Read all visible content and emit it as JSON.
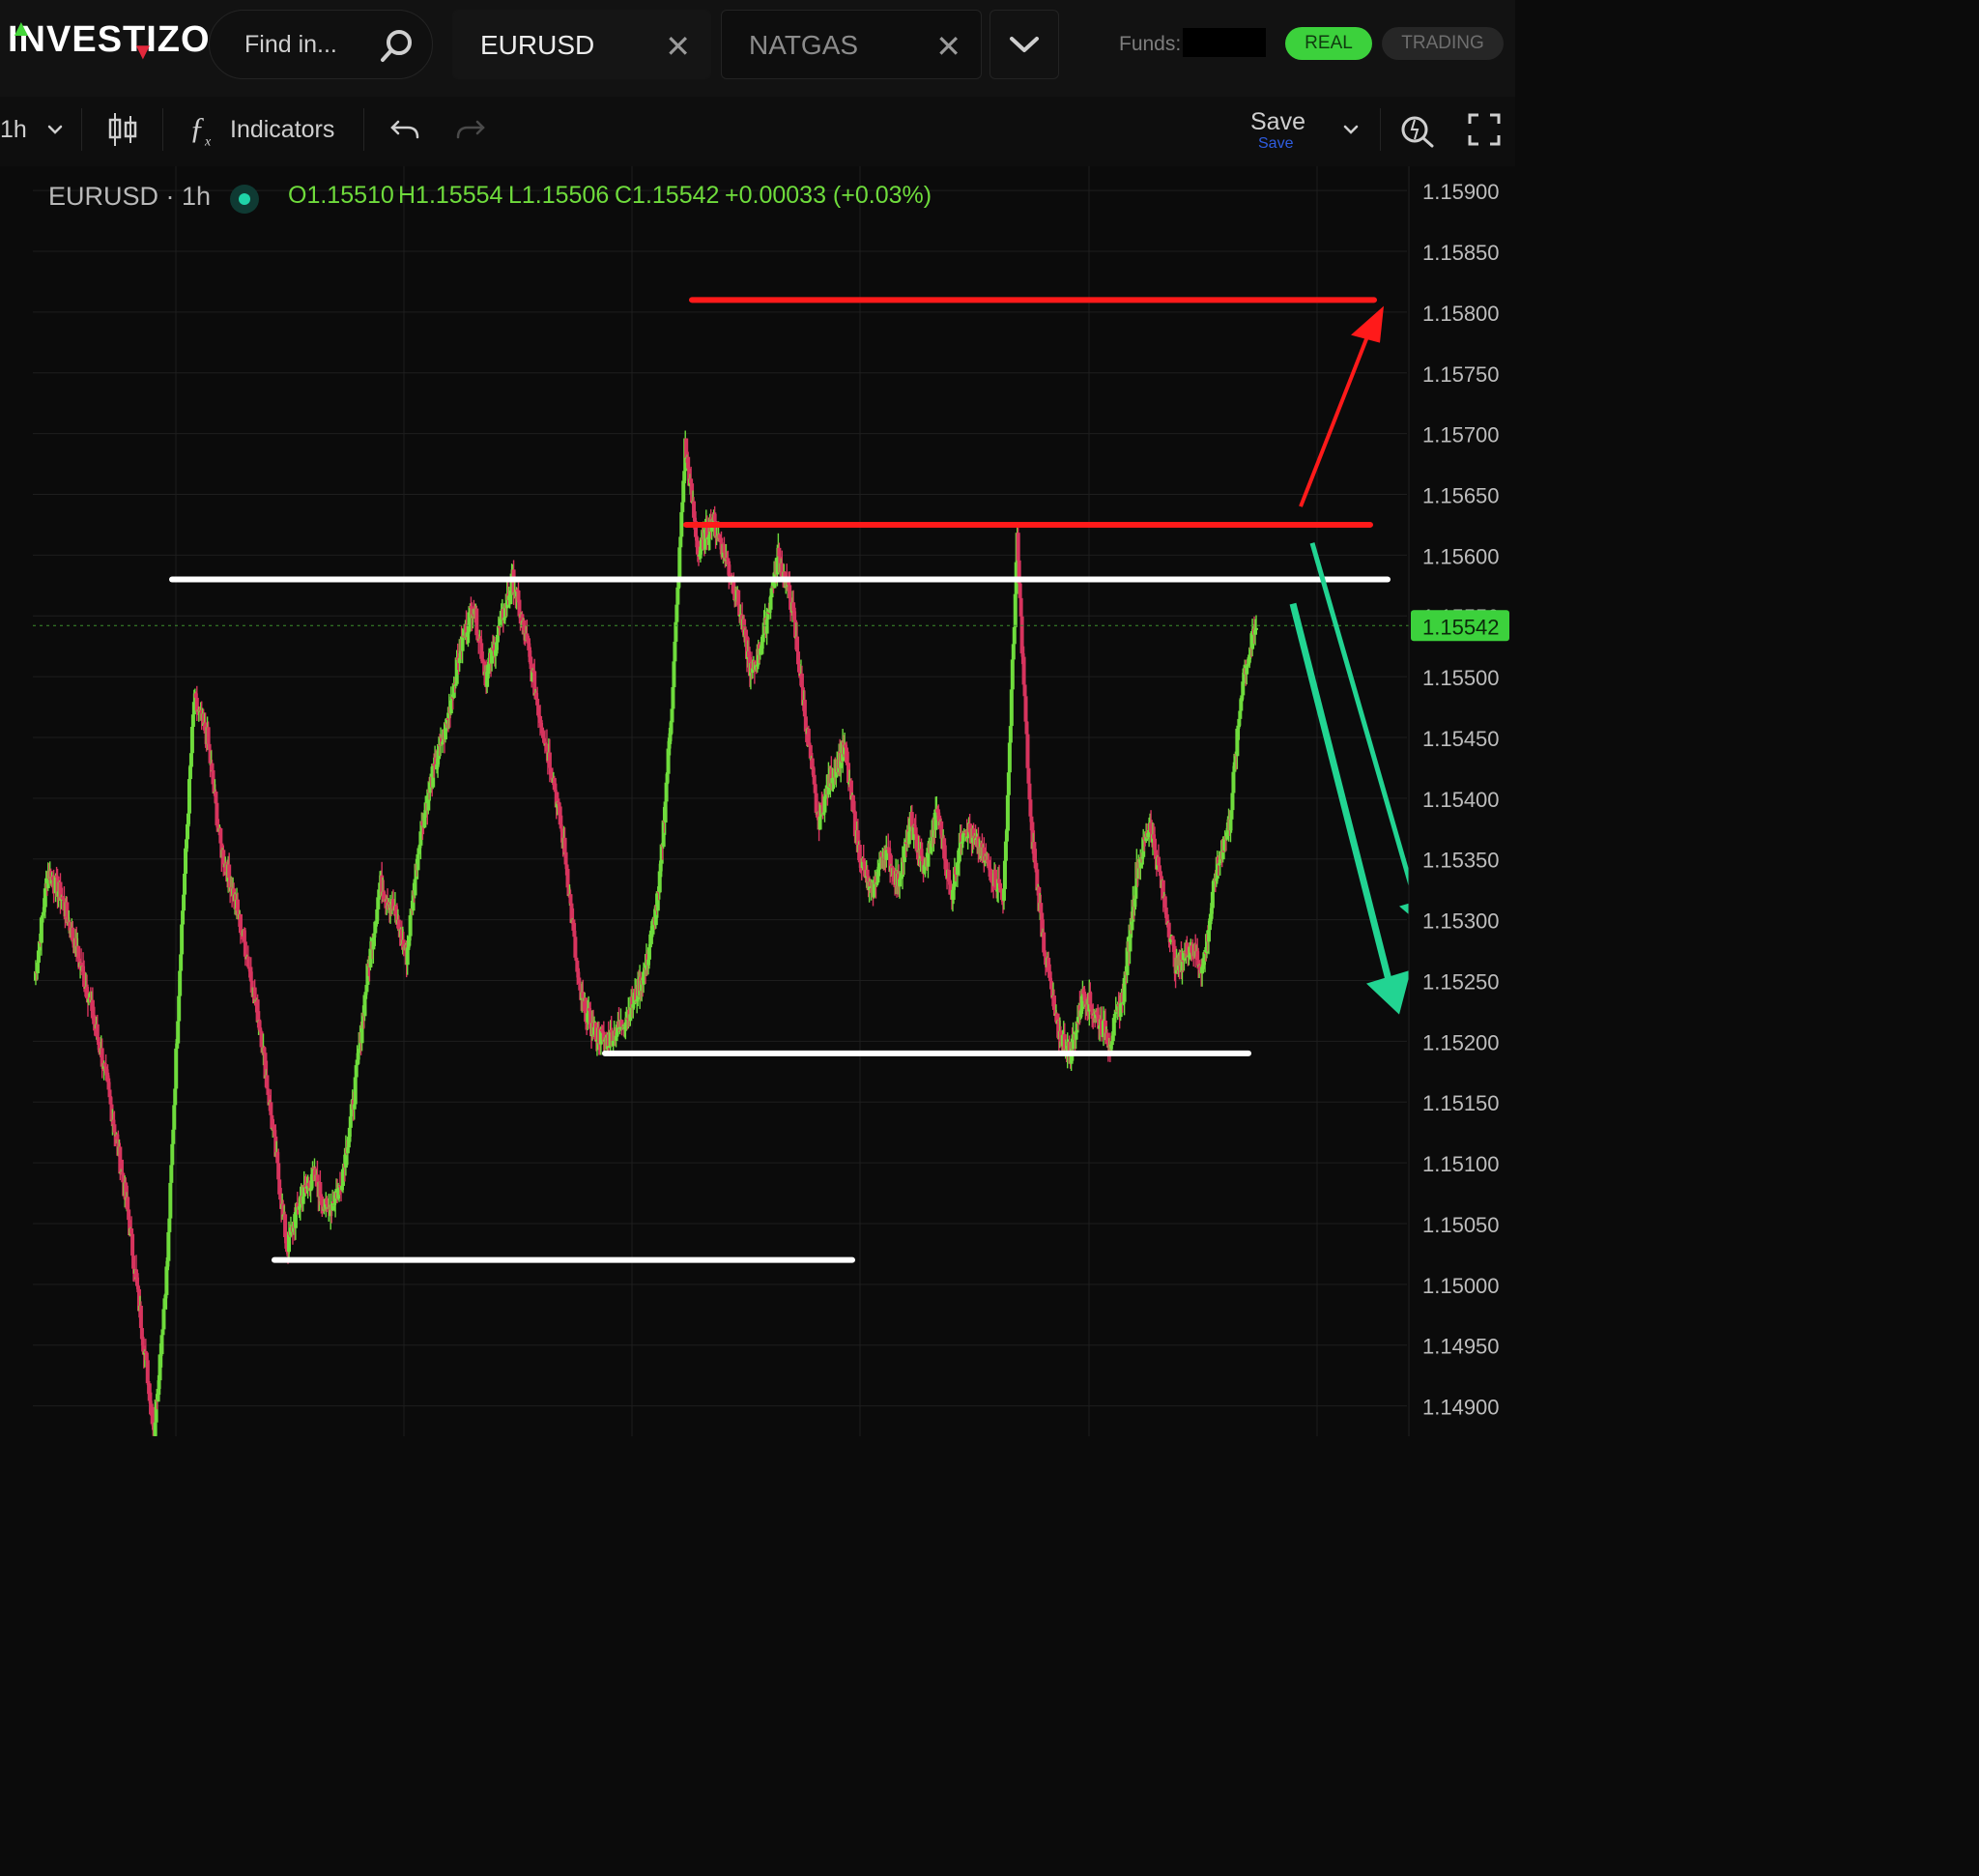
{
  "app": {
    "logo": "INVESTIZO",
    "search_placeholder": "Find in...",
    "tabs": [
      {
        "label": "EURUSD",
        "active": true
      },
      {
        "label": "NATGAS",
        "active": false
      }
    ],
    "funds_label": "Funds:",
    "mode_real": "REAL",
    "mode_trading": "TRADING"
  },
  "toolbar": {
    "interval": "1h",
    "indicators_label": "Indicators",
    "save_label": "Save",
    "save_sub_label": "Save"
  },
  "legend": {
    "symbol": "EURUSD · 1h",
    "open": "O1.15510",
    "high": "H1.15554",
    "low": "L1.15506",
    "close": "C1.15542",
    "change": "+0.00033 (+0.03%)"
  },
  "colors": {
    "up": "#6fdc3c",
    "down": "#d7345e",
    "grid": "#1e1e1e",
    "resistance_line": "#ff1a1a",
    "support_line": "#ffffff",
    "arrow_red": "#ff1a1a",
    "arrow_green": "#22d492",
    "price_tag": "#3cd13c"
  },
  "chart_data": {
    "type": "candlestick",
    "symbol": "EURUSD",
    "interval": "1h",
    "ylim": [
      1.14875,
      1.1592
    ],
    "y_ticks": [
      "1.15900",
      "1.15850",
      "1.15800",
      "1.15750",
      "1.15700",
      "1.15650",
      "1.15600",
      "1.15550",
      "1.15500",
      "1.15450",
      "1.15400",
      "1.15350",
      "1.15300",
      "1.15250",
      "1.15200",
      "1.15150",
      "1.15100",
      "1.15050",
      "1.15000",
      "1.14950",
      "1.14900"
    ],
    "last_price": "1.15542",
    "closes": [
      1.1525,
      1.1534,
      1.1532,
      1.1528,
      1.1524,
      1.1519,
      1.1513,
      1.1506,
      1.1497,
      1.1488,
      1.1502,
      1.1528,
      1.1548,
      1.1545,
      1.1536,
      1.1532,
      1.1527,
      1.1521,
      1.1512,
      1.1503,
      1.1507,
      1.1509,
      1.1506,
      1.1508,
      1.1515,
      1.1525,
      1.1533,
      1.1531,
      1.1527,
      1.1537,
      1.1542,
      1.1546,
      1.1552,
      1.1556,
      1.155,
      1.1554,
      1.1558,
      1.1553,
      1.1547,
      1.1542,
      1.1535,
      1.1524,
      1.1521,
      1.152,
      1.1521,
      1.1523,
      1.1526,
      1.1532,
      1.1548,
      1.1569,
      1.156,
      1.1563,
      1.156,
      1.1556,
      1.155,
      1.1554,
      1.156,
      1.1556,
      1.1547,
      1.1538,
      1.1542,
      1.1544,
      1.1536,
      1.1532,
      1.1536,
      1.1533,
      1.1538,
      1.1534,
      1.1539,
      1.1532,
      1.1538,
      1.1536,
      1.1534,
      1.1532,
      1.1561,
      1.1538,
      1.1528,
      1.1521,
      1.1519,
      1.1524,
      1.1522,
      1.152,
      1.1524,
      1.1534,
      1.1538,
      1.1532,
      1.1526,
      1.1528,
      1.1526,
      1.1534,
      1.1538,
      1.155,
      1.1554
    ],
    "horizontal_lines": [
      {
        "price": 1.1581,
        "color": "red"
      },
      {
        "price": 1.15625,
        "color": "red"
      },
      {
        "price": 1.1558,
        "color": "white"
      },
      {
        "price": 1.1519,
        "color": "white"
      },
      {
        "price": 1.1502,
        "color": "white"
      }
    ],
    "annotations": [
      {
        "type": "arrow",
        "color": "red",
        "direction": "up"
      },
      {
        "type": "arrow",
        "color": "green",
        "direction": "down"
      },
      {
        "type": "arrow",
        "color": "green",
        "direction": "down"
      }
    ]
  }
}
